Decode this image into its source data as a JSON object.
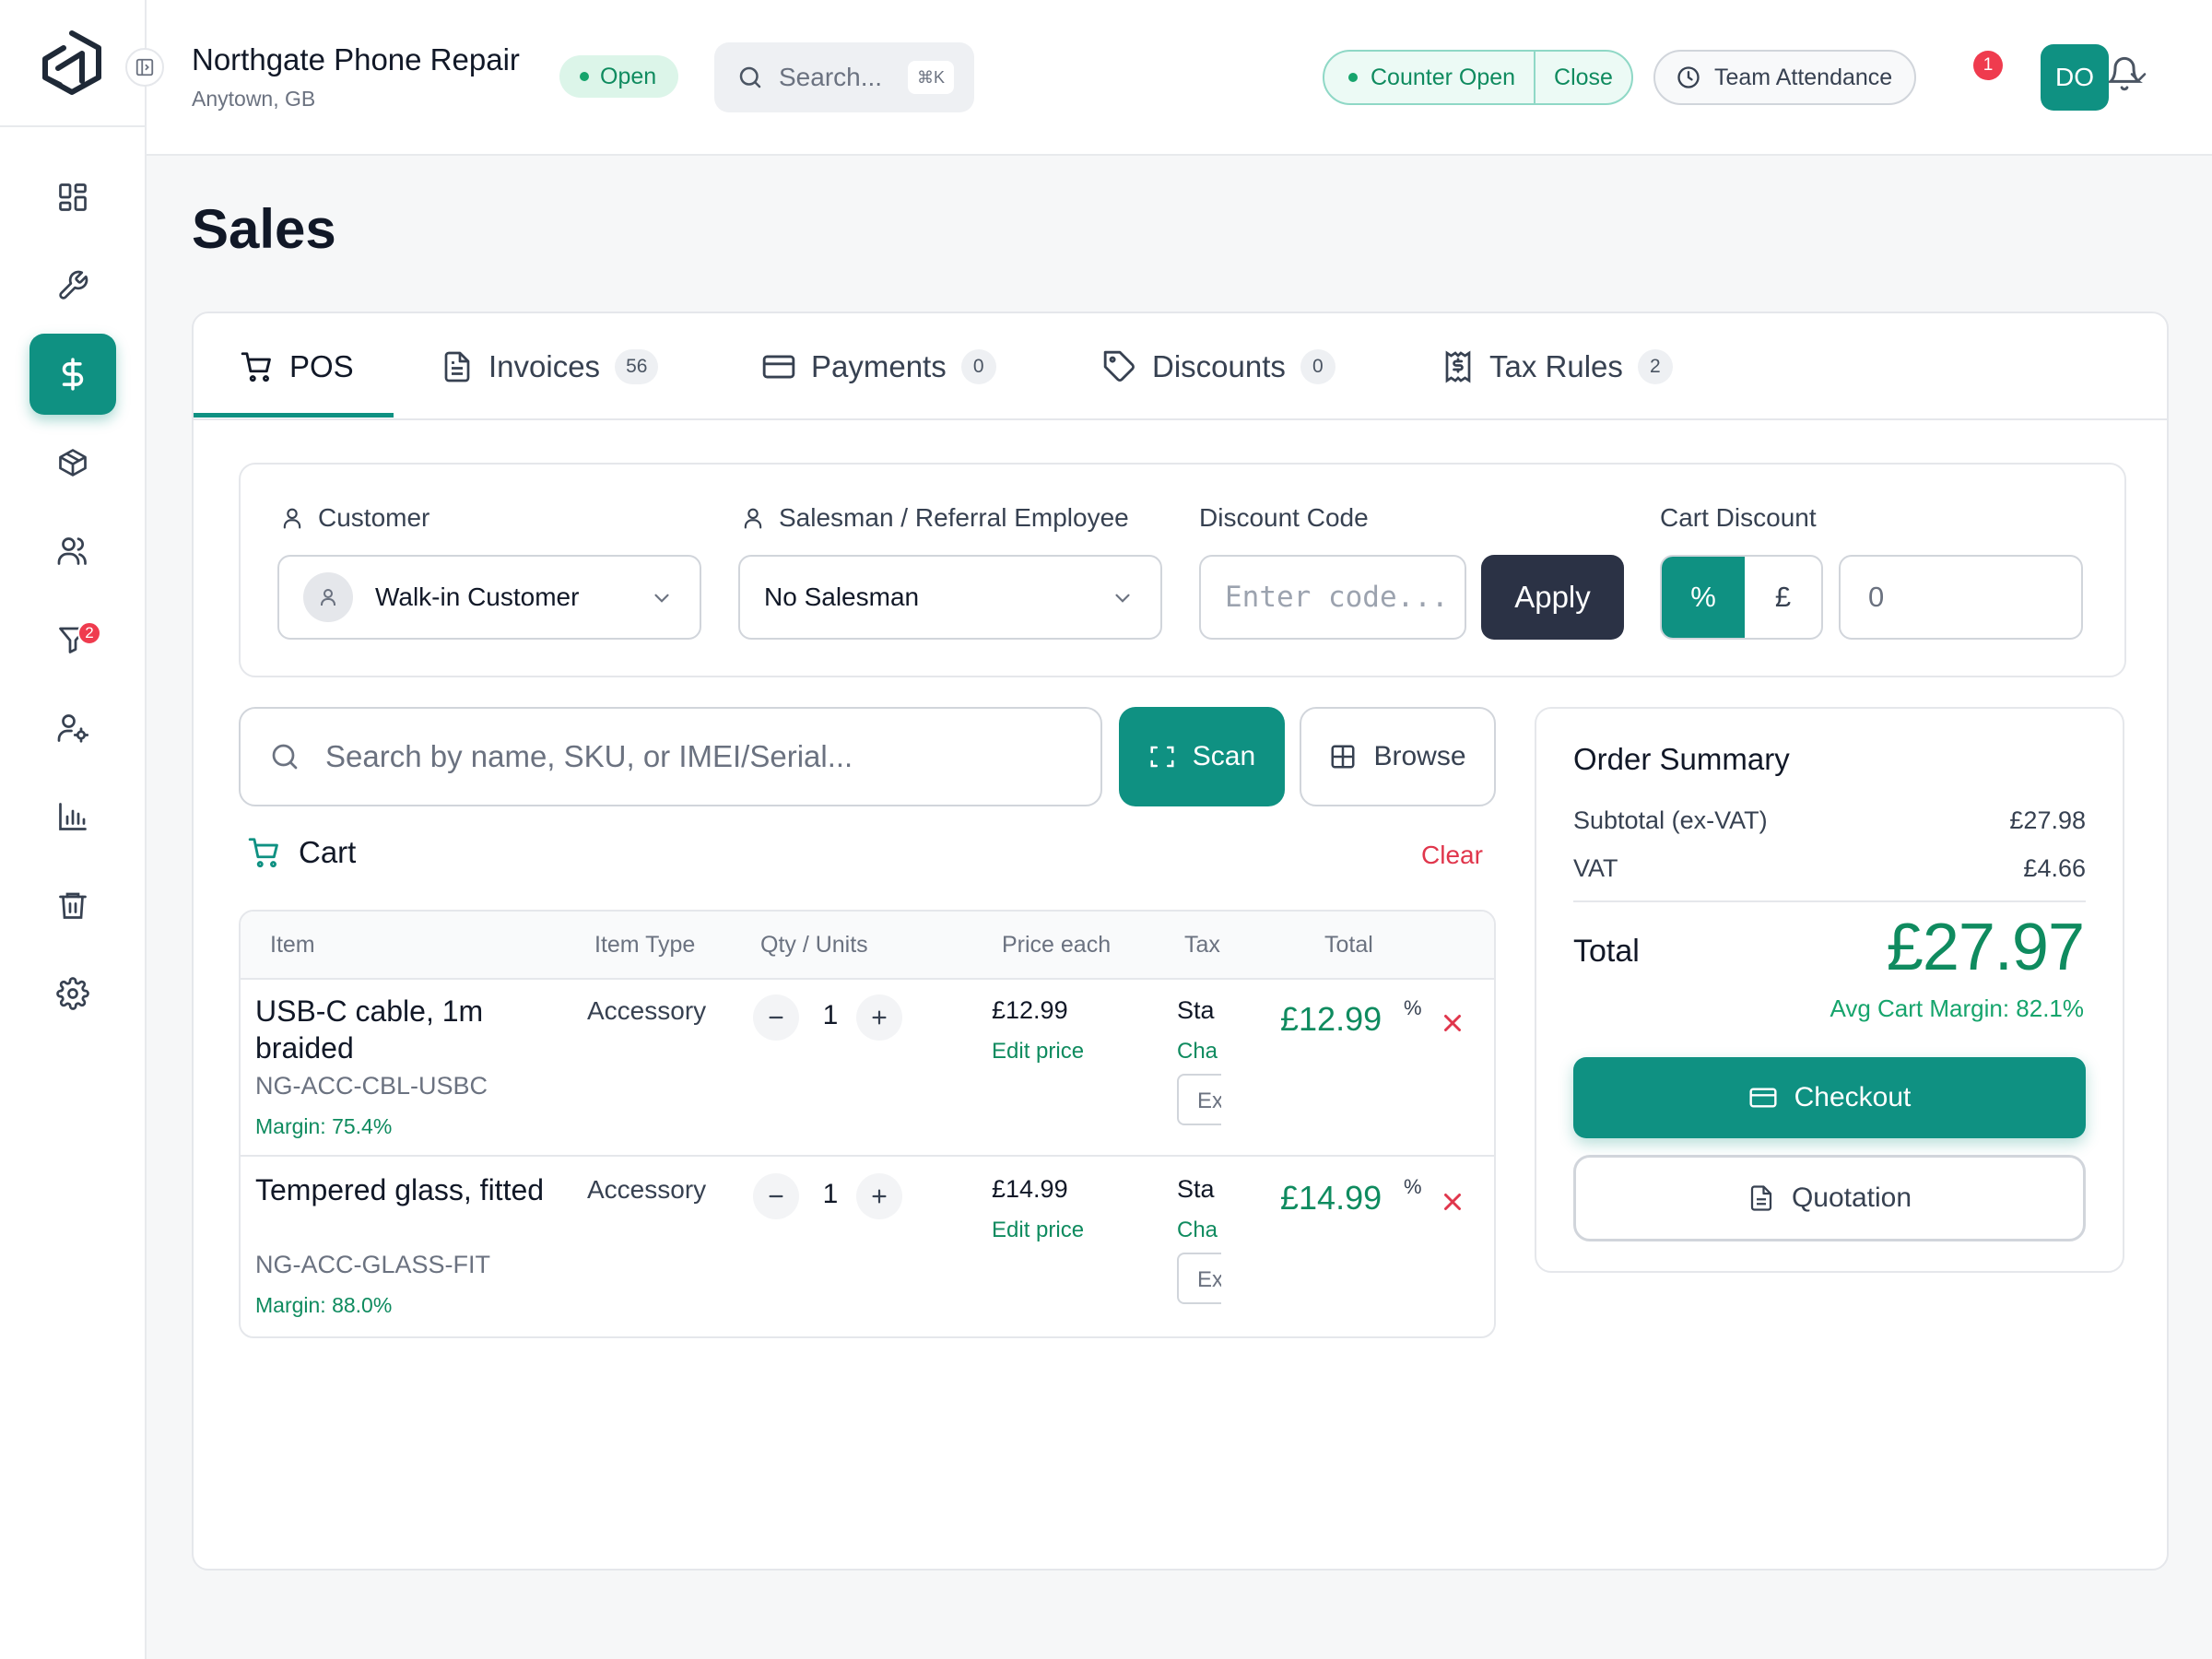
{
  "header": {
    "shop_name": "Northgate Phone Repair",
    "shop_location": "Anytown, GB",
    "status": "Open",
    "search_placeholder": "Search...",
    "search_shortcut": "⌘K",
    "counter_status": "Counter Open",
    "counter_close": "Close",
    "team_attendance": "Team Attendance",
    "notification_count": "1",
    "user_initials": "DO"
  },
  "sidebar": {
    "items": [
      {
        "name": "dashboard",
        "icon": "grid-icon"
      },
      {
        "name": "repairs",
        "icon": "wrench-icon"
      },
      {
        "name": "sales",
        "icon": "dollar-icon",
        "active": true
      },
      {
        "name": "inventory",
        "icon": "box-icon"
      },
      {
        "name": "customers",
        "icon": "users-icon"
      },
      {
        "name": "leads",
        "icon": "filter-icon",
        "badge": "2"
      },
      {
        "name": "employees",
        "icon": "user-settings-icon"
      },
      {
        "name": "reports",
        "icon": "bar-chart-icon"
      },
      {
        "name": "trash",
        "icon": "trash-icon"
      },
      {
        "name": "settings",
        "icon": "gear-icon"
      }
    ],
    "leads_badge": "2"
  },
  "page": {
    "title": "Sales"
  },
  "tabs": [
    {
      "label": "POS",
      "icon": "cart-icon"
    },
    {
      "label": "Invoices",
      "count": "56",
      "icon": "document-icon"
    },
    {
      "label": "Payments",
      "count": "0",
      "icon": "credit-card-icon"
    },
    {
      "label": "Discounts",
      "count": "0",
      "icon": "tag-icon"
    },
    {
      "label": "Tax Rules",
      "count": "2",
      "icon": "receipt-icon"
    }
  ],
  "filters": {
    "customer_label": "Customer",
    "customer_value": "Walk-in Customer",
    "salesman_label": "Salesman / Referral Employee",
    "salesman_value": "No Salesman",
    "discount_code_label": "Discount Code",
    "discount_code_placeholder": "Enter code...",
    "apply_label": "Apply",
    "cart_discount_label": "Cart Discount",
    "discount_percent": "%",
    "discount_pound": "£",
    "discount_value": "0"
  },
  "product_search": {
    "placeholder": "Search by name, SKU, or IMEI/Serial...",
    "scan_label": "Scan",
    "browse_label": "Browse"
  },
  "cart": {
    "title": "Cart",
    "clear_label": "Clear",
    "columns": [
      "Item",
      "Item Type",
      "Qty / Units",
      "Price each",
      "Tax",
      "Total"
    ],
    "rows": [
      {
        "name": "USB-C cable, 1m braided",
        "sku": "NG-ACC-CBL-USBC",
        "margin": "Margin: 75.4%",
        "type": "Accessory",
        "qty": "1",
        "price": "£12.99",
        "edit_price": "Edit price",
        "tax_rule": "Sta",
        "tax_change": "Cha",
        "tax_mode": "Ex",
        "total": "£12.99",
        "symbol": "%"
      },
      {
        "name": "Tempered glass, fitted",
        "sku": "NG-ACC-GLASS-FIT",
        "margin": "Margin: 88.0%",
        "type": "Accessory",
        "qty": "1",
        "price": "£14.99",
        "edit_price": "Edit price",
        "tax_rule": "Sta",
        "tax_change": "Cha",
        "tax_mode": "Ex",
        "total": "£14.99",
        "symbol": "%"
      }
    ]
  },
  "summary": {
    "title": "Order Summary",
    "subtotal_label": "Subtotal (ex-VAT)",
    "subtotal": "£27.98",
    "vat_label": "VAT",
    "vat": "£4.66",
    "total_label": "Total",
    "total": "£27.97",
    "avg_margin": "Avg Cart Margin: 82.1%",
    "checkout_label": "Checkout",
    "quotation_label": "Quotation"
  },
  "colors": {
    "accent": "#0f9182",
    "success_text": "#0f8b5f",
    "danger": "#e0364c",
    "dark_button": "#2b3245"
  }
}
